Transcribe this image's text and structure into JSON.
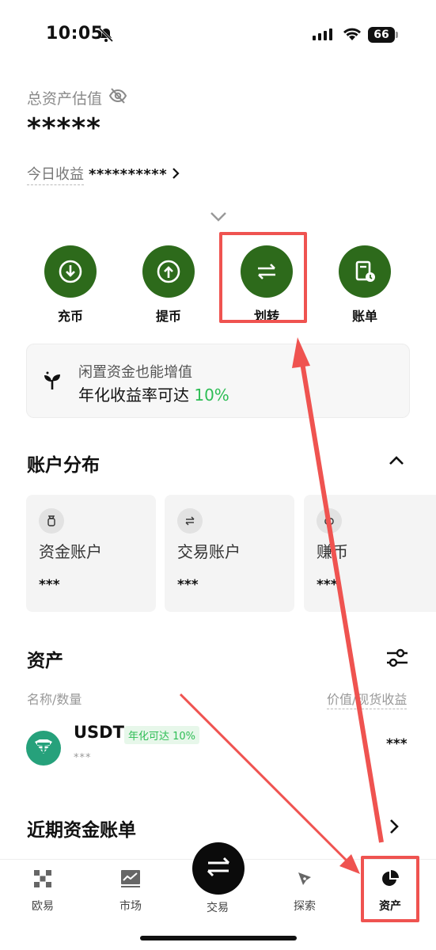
{
  "status_bar": {
    "time": "10:05",
    "battery": "66"
  },
  "assets_header": {
    "estimate_label": "总资产估值",
    "estimate_value": "*****",
    "today_label": "今日收益",
    "today_value": "**********"
  },
  "actions": [
    {
      "label": "充币",
      "icon": "download-icon"
    },
    {
      "label": "提币",
      "icon": "upload-icon"
    },
    {
      "label": "划转",
      "icon": "transfer-icon"
    },
    {
      "label": "账单",
      "icon": "bill-icon"
    }
  ],
  "promo": {
    "line1": "闲置资金也能增值",
    "line2": "年化收益率可达",
    "percent": "10%"
  },
  "account_section": {
    "title": "账户分布",
    "cards": [
      {
        "name": "资金账户",
        "value": "***",
        "icon": "bag-icon"
      },
      {
        "name": "交易账户",
        "value": "***",
        "icon": "swap-icon"
      },
      {
        "name": "赚币",
        "value": "***",
        "icon": "piggy-icon"
      }
    ]
  },
  "asset_section": {
    "title": "资产",
    "col_left": "名称/数量",
    "col_right": "价值/现货收益",
    "rows": [
      {
        "name": "USDT",
        "badge": "年化可达 10%",
        "amount": "***",
        "value": "***"
      }
    ]
  },
  "recent_section": {
    "title": "近期资金账单"
  },
  "tabbar": {
    "items": [
      {
        "label": "欧易",
        "icon": "okx-logo-icon"
      },
      {
        "label": "市场",
        "icon": "market-chart-icon"
      },
      {
        "label": "交易",
        "icon": "trade-swap-icon"
      },
      {
        "label": "探索",
        "icon": "compass-icon"
      },
      {
        "label": "资产",
        "icon": "pie-chart-icon"
      }
    ]
  },
  "colors": {
    "brand_green": "#2d6a1b",
    "gain_green": "#2ebd55",
    "annotation_red": "#ef5350"
  }
}
